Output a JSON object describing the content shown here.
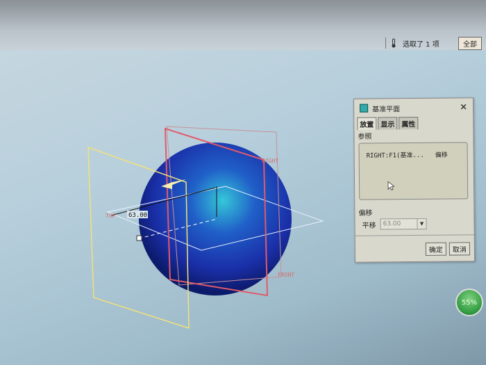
{
  "statusbar": {
    "selection_text": "选取了 1 项",
    "filter_value": "全部"
  },
  "viewport": {
    "labels": {
      "top": "TOP",
      "right": "RIGHT",
      "front": "FRONT"
    },
    "dimension_value": "63.00",
    "colors": {
      "sphere": "#1a2fa8",
      "datum_selected": "#f2e27a",
      "datum_right": "#e05a6a"
    }
  },
  "dialog": {
    "title": "基准平面",
    "close_icon": "close-icon",
    "tabs": [
      {
        "label": "放置",
        "active": true
      },
      {
        "label": "显示"
      },
      {
        "label": "属性"
      }
    ],
    "references_label": "参照",
    "references": [
      {
        "name": "RIGHT:F1(基准...",
        "type": "偏移"
      }
    ],
    "offset_section_label": "偏移",
    "translation_label": "平移",
    "translation_value": "63.00",
    "ok_label": "确定",
    "cancel_label": "取消"
  },
  "gauge": {
    "percent_text": "55%"
  }
}
